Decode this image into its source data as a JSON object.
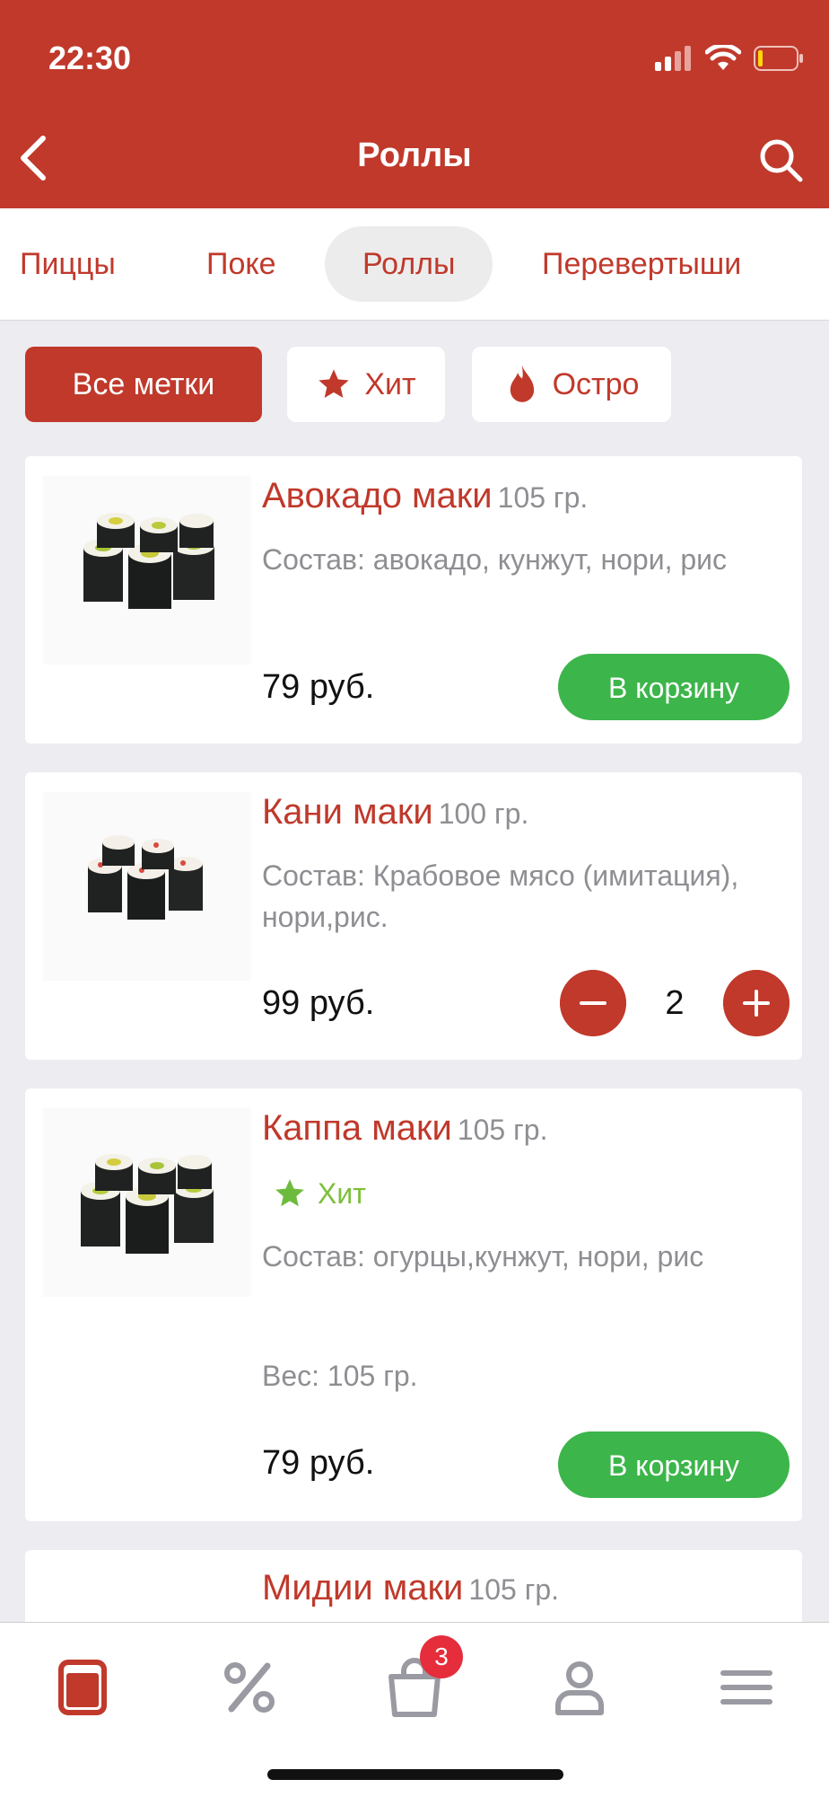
{
  "status": {
    "time": "22:30"
  },
  "nav": {
    "title": "Роллы"
  },
  "tabs": [
    {
      "label": "Пиццы"
    },
    {
      "label": "Поке"
    },
    {
      "label": "Роллы",
      "active": true
    },
    {
      "label": "Перевертыши"
    }
  ],
  "filters": {
    "all": "Все метки",
    "hit": "Хит",
    "spicy": "Остро"
  },
  "products": [
    {
      "name": "Авокадо маки",
      "weight": "105 гр.",
      "composition": "Состав: авокадо, кунжут, нори, рис",
      "price": "79 руб.",
      "button": "В корзину"
    },
    {
      "name": "Кани маки",
      "weight": "100 гр.",
      "composition": "Состав: Крабовое мясо (имитация), нори,рис.",
      "price": "99 руб.",
      "quantity": "2"
    },
    {
      "name": "Каппа маки",
      "weight": "105 гр.",
      "tag": "Хит",
      "composition": "Состав: огурцы,кунжут, нори, рис",
      "weight_line": "Вес: 105 гр.",
      "price": "79 руб.",
      "button": "В корзину"
    },
    {
      "name": "Мидии маки",
      "weight": "105 гр."
    }
  ],
  "tabbar": {
    "cart_count": "3"
  },
  "colors": {
    "brand": "#c0392b",
    "accent_green": "#3cb54a",
    "hit_green": "#7cbf3a",
    "badge": "#e52d3c"
  }
}
